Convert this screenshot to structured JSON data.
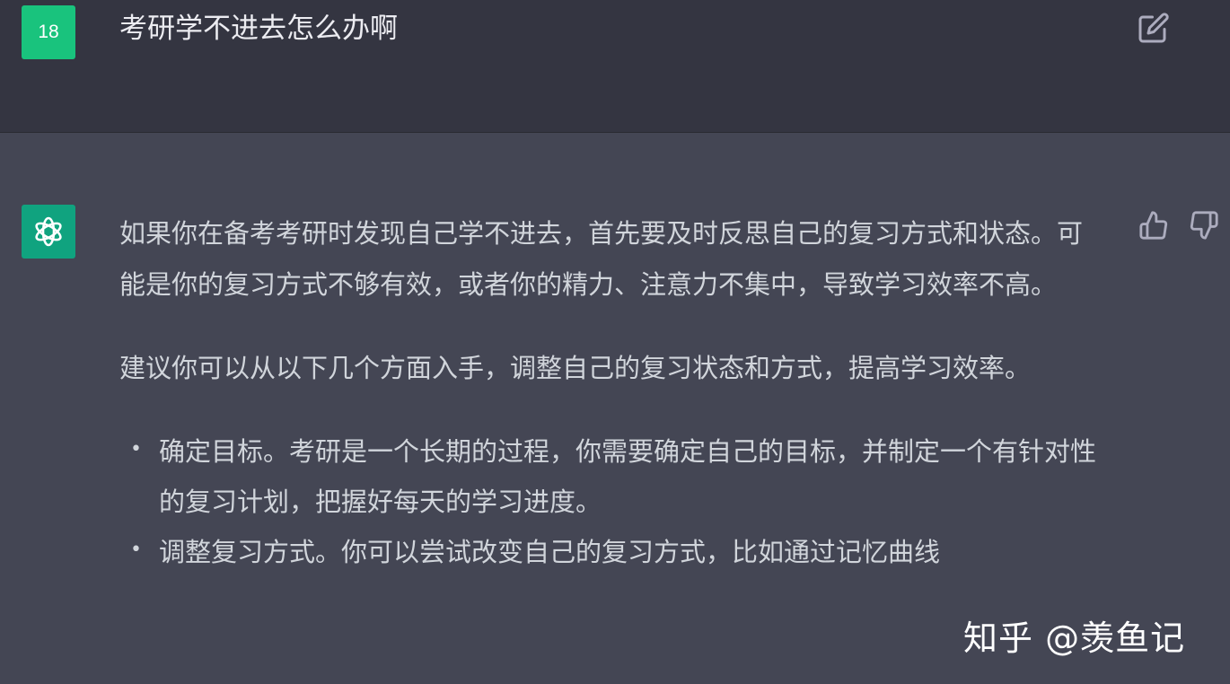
{
  "user_message": {
    "avatar_text": "18",
    "text": "考研学不进去怎么办啊"
  },
  "assistant_message": {
    "paragraphs": [
      "如果你在备考考研时发现自己学不进去，首先要及时反思自己的复习方式和状态。可能是你的复习方式不够有效，或者你的精力、注意力不集中，导致学习效率不高。",
      "建议你可以从以下几个方面入手，调整自己的复习状态和方式，提高学习效率。"
    ],
    "bullets": [
      "确定目标。考研是一个长期的过程，你需要确定自己的目标，并制定一个有针对性的复习计划，把握好每天的学习进度。",
      "调整复习方式。你可以尝试改变自己的复习方式，比如通过记忆曲线"
    ]
  },
  "icons": {
    "edit": "edit-icon",
    "thumbs_up": "thumbs-up-icon",
    "thumbs_down": "thumbs-down-icon",
    "openai_logo": "openai-logo-icon"
  },
  "watermark": "知乎 @羡鱼记",
  "colors": {
    "user_bg": "#343541",
    "assistant_bg": "#444654",
    "user_avatar": "#19c37d",
    "gpt_avatar": "#10a37f",
    "text": "#d1d5db"
  }
}
